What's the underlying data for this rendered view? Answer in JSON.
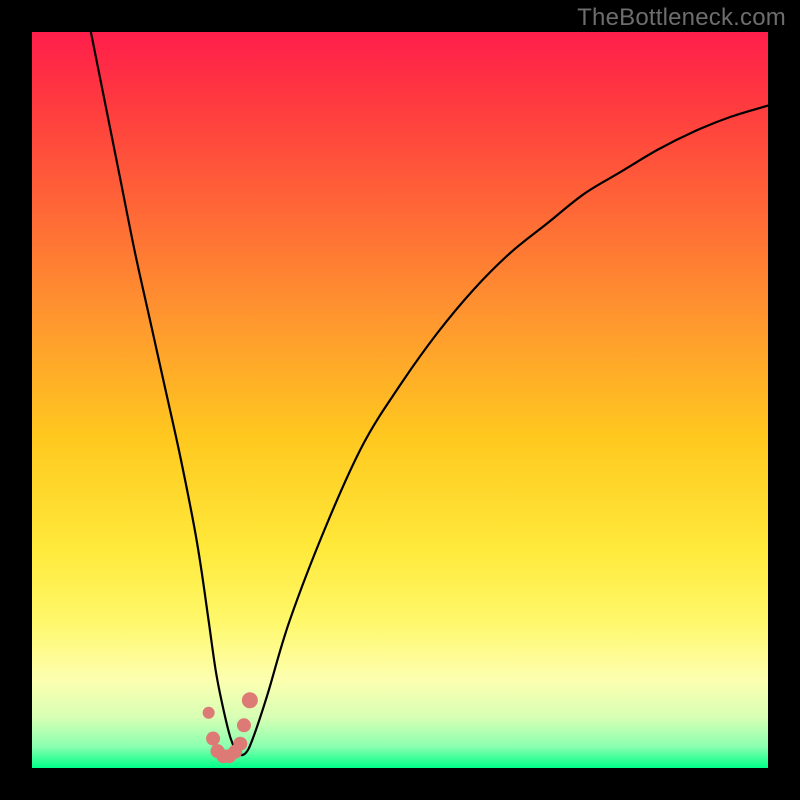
{
  "watermark": "TheBottleneck.com",
  "colors": {
    "frame": "#000000",
    "curve_stroke": "#000000",
    "marker_fill": "#de7a75",
    "gradient_stops": [
      {
        "offset": 0.0,
        "color": "#ff1e4b"
      },
      {
        "offset": 0.1,
        "color": "#ff3b3f"
      },
      {
        "offset": 0.25,
        "color": "#ff6a36"
      },
      {
        "offset": 0.4,
        "color": "#ff9a2e"
      },
      {
        "offset": 0.55,
        "color": "#ffc81f"
      },
      {
        "offset": 0.7,
        "color": "#ffe93a"
      },
      {
        "offset": 0.8,
        "color": "#fff86a"
      },
      {
        "offset": 0.88,
        "color": "#fdffb0"
      },
      {
        "offset": 0.93,
        "color": "#d8ffb4"
      },
      {
        "offset": 0.97,
        "color": "#8dffb0"
      },
      {
        "offset": 1.0,
        "color": "#00ff88"
      }
    ]
  },
  "chart_data": {
    "type": "line",
    "title": "",
    "xlabel": "",
    "ylabel": "",
    "xlim": [
      0,
      100
    ],
    "ylim": [
      0,
      100
    ],
    "grid": false,
    "legend": false,
    "series": [
      {
        "name": "bottleneck-curve",
        "x": [
          8,
          10,
          12,
          14,
          16,
          18,
          20,
          22,
          23,
          24,
          25,
          26,
          27,
          28,
          29,
          30,
          32,
          35,
          40,
          45,
          50,
          55,
          60,
          65,
          70,
          75,
          80,
          85,
          90,
          95,
          100
        ],
        "y": [
          100,
          90,
          80,
          70,
          61,
          52,
          43,
          33,
          27,
          20,
          13,
          8,
          4,
          2,
          2,
          4,
          10,
          20,
          33,
          44,
          52,
          59,
          65,
          70,
          74,
          78,
          81,
          84,
          86.5,
          88.5,
          90
        ]
      }
    ],
    "markers": {
      "name": "bottom-cluster",
      "x": [
        24.0,
        24.6,
        25.2,
        26.0,
        26.8,
        27.6,
        28.3,
        28.8,
        29.6
      ],
      "y": [
        7.5,
        4.0,
        2.3,
        1.6,
        1.6,
        2.2,
        3.3,
        5.8,
        9.2
      ],
      "r": [
        6,
        7,
        7,
        7,
        7,
        7,
        7,
        7,
        8
      ]
    }
  }
}
